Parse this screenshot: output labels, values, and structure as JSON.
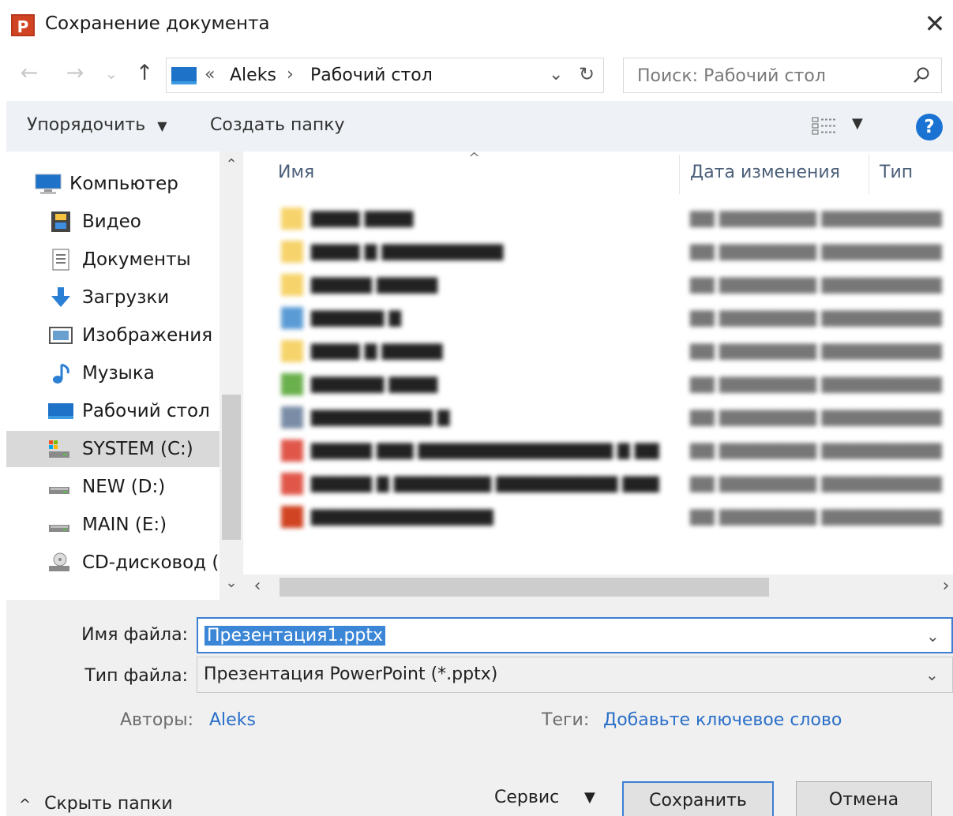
{
  "window": {
    "title": "Сохранение документа",
    "app_icon": "P",
    "close": "✕"
  },
  "nav": {
    "back": "←",
    "forward": "→",
    "recent": "⌄",
    "up": "↑",
    "address": {
      "overflow": "«",
      "parts": [
        "Aleks",
        "Рабочий стол"
      ],
      "sep": "›",
      "dropdown": "⌄",
      "refresh": "↻"
    },
    "search_placeholder": "Поиск: Рабочий стол"
  },
  "toolbar": {
    "organize": "Упорядочить",
    "organize_arrow": "▼",
    "new_folder": "Создать папку",
    "view_arrow": "▼",
    "help": "?"
  },
  "sidebar": {
    "items": [
      {
        "label": "Компьютер",
        "icon": "computer-icon"
      },
      {
        "label": "Видео",
        "icon": "video-icon"
      },
      {
        "label": "Документы",
        "icon": "documents-icon"
      },
      {
        "label": "Загрузки",
        "icon": "downloads-icon"
      },
      {
        "label": "Изображения",
        "icon": "pictures-icon"
      },
      {
        "label": "Музыка",
        "icon": "music-icon"
      },
      {
        "label": "Рабочий стол",
        "icon": "desktop-icon"
      },
      {
        "label": "SYSTEM (C:)",
        "icon": "system-drive-icon",
        "selected": true
      },
      {
        "label": "NEW (D:)",
        "icon": "drive-icon"
      },
      {
        "label": "MAIN (E:)",
        "icon": "drive-icon"
      },
      {
        "label": "CD-дисковод (H",
        "icon": "cd-drive-icon"
      }
    ],
    "scroll_up": "⌃",
    "scroll_down": "⌄"
  },
  "filelist": {
    "columns": {
      "name": "Имя",
      "date": "Дата изменения",
      "type": "Тип"
    },
    "sort_arrow": "^",
    "h_scroll_left": "‹",
    "h_scroll_right": "›"
  },
  "form": {
    "filename_label": "Имя файла:",
    "filename_value": "Презентация1.pptx",
    "filetype_label": "Тип файла:",
    "filetype_value": "Презентация PowerPoint (*.pptx)",
    "dropdown": "⌄",
    "authors_label": "Авторы:",
    "authors_value": "Aleks",
    "tags_label": "Теги:",
    "tags_value": "Добавьте ключевое слово"
  },
  "footer": {
    "hide_folders": "Скрыть папки",
    "hide_arrow": "^",
    "service": "Сервис",
    "service_arrow": "▼",
    "save": "Сохранить",
    "cancel": "Отмена"
  },
  "colors": {
    "accent": "#3c7fd4",
    "selection": "#3b86d6",
    "toolbar_bg": "#eef2f6",
    "panel_bg": "#f0f0f0",
    "link": "#2a6fc9"
  }
}
